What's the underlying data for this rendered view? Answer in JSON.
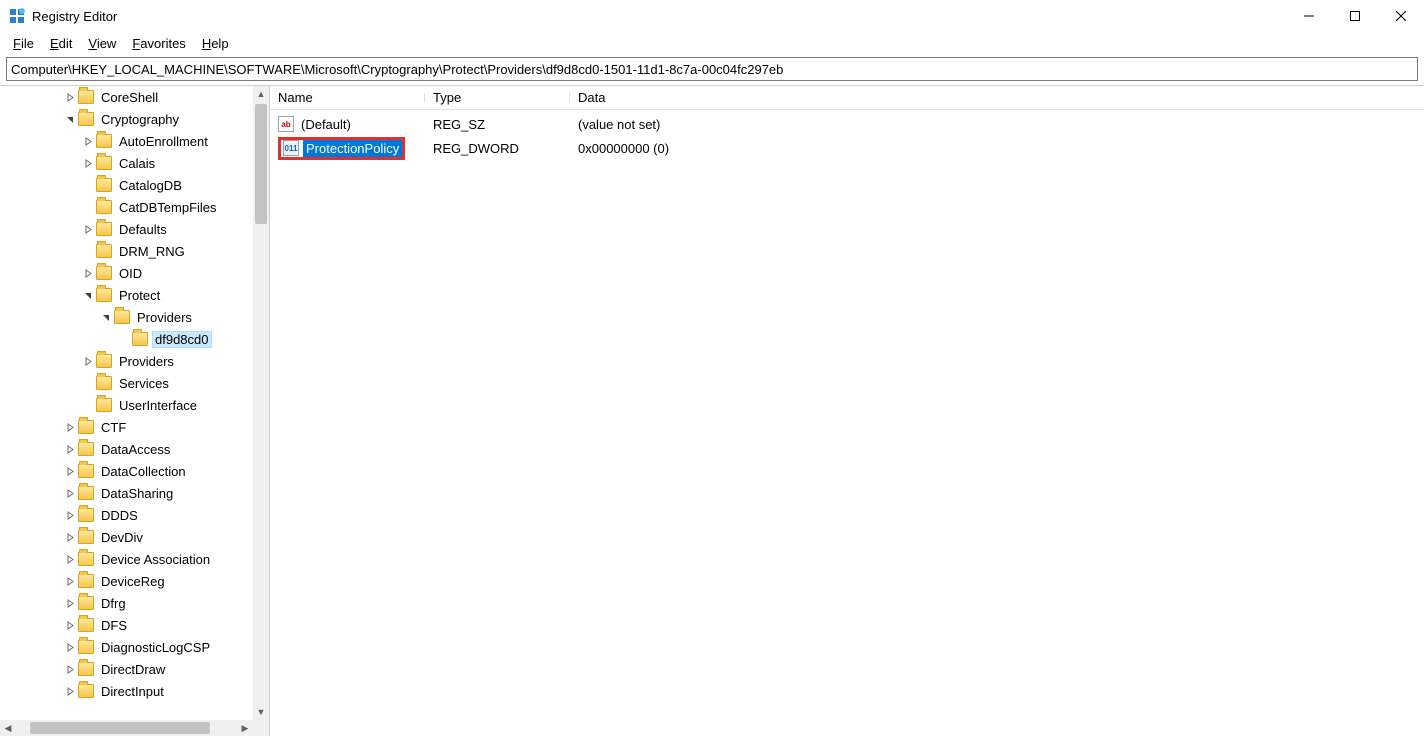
{
  "window": {
    "title": "Registry Editor"
  },
  "menu": {
    "file": "File",
    "edit": "Edit",
    "view": "View",
    "favorites": "Favorites",
    "help": "Help"
  },
  "address": "Computer\\HKEY_LOCAL_MACHINE\\SOFTWARE\\Microsoft\\Cryptography\\Protect\\Providers\\df9d8cd0-1501-11d1-8c7a-00c04fc297eb",
  "tree": [
    {
      "indent": 3,
      "chev": "closed",
      "label": "CoreShell"
    },
    {
      "indent": 3,
      "chev": "open",
      "label": "Cryptography"
    },
    {
      "indent": 4,
      "chev": "closed",
      "label": "AutoEnrollment"
    },
    {
      "indent": 4,
      "chev": "closed",
      "label": "Calais"
    },
    {
      "indent": 4,
      "chev": "",
      "label": "CatalogDB"
    },
    {
      "indent": 4,
      "chev": "",
      "label": "CatDBTempFiles"
    },
    {
      "indent": 4,
      "chev": "closed",
      "label": "Defaults"
    },
    {
      "indent": 4,
      "chev": "",
      "label": "DRM_RNG"
    },
    {
      "indent": 4,
      "chev": "closed",
      "label": "OID"
    },
    {
      "indent": 4,
      "chev": "open",
      "label": "Protect"
    },
    {
      "indent": 5,
      "chev": "open",
      "label": "Providers"
    },
    {
      "indent": 6,
      "chev": "",
      "label": "df9d8cd0",
      "selected": true
    },
    {
      "indent": 4,
      "chev": "closed",
      "label": "Providers"
    },
    {
      "indent": 4,
      "chev": "",
      "label": "Services"
    },
    {
      "indent": 4,
      "chev": "",
      "label": "UserInterface"
    },
    {
      "indent": 3,
      "chev": "closed",
      "label": "CTF"
    },
    {
      "indent": 3,
      "chev": "closed",
      "label": "DataAccess"
    },
    {
      "indent": 3,
      "chev": "closed",
      "label": "DataCollection"
    },
    {
      "indent": 3,
      "chev": "closed",
      "label": "DataSharing"
    },
    {
      "indent": 3,
      "chev": "closed",
      "label": "DDDS"
    },
    {
      "indent": 3,
      "chev": "closed",
      "label": "DevDiv"
    },
    {
      "indent": 3,
      "chev": "closed",
      "label": "Device Association"
    },
    {
      "indent": 3,
      "chev": "closed",
      "label": "DeviceReg"
    },
    {
      "indent": 3,
      "chev": "closed",
      "label": "Dfrg"
    },
    {
      "indent": 3,
      "chev": "closed",
      "label": "DFS"
    },
    {
      "indent": 3,
      "chev": "closed",
      "label": "DiagnosticLogCSP"
    },
    {
      "indent": 3,
      "chev": "closed",
      "label": "DirectDraw"
    },
    {
      "indent": 3,
      "chev": "closed",
      "label": "DirectInput"
    }
  ],
  "columns": {
    "name": "Name",
    "type": "Type",
    "data": "Data"
  },
  "values": [
    {
      "icon": "sz",
      "name": "(Default)",
      "type": "REG_SZ",
      "data": "(value not set)",
      "selected": false,
      "highlight": false
    },
    {
      "icon": "dw",
      "name": "ProtectionPolicy",
      "type": "REG_DWORD",
      "data": "0x00000000 (0)",
      "selected": true,
      "highlight": true
    }
  ],
  "icon_text": {
    "sz": "ab",
    "dw": "011\n110"
  }
}
